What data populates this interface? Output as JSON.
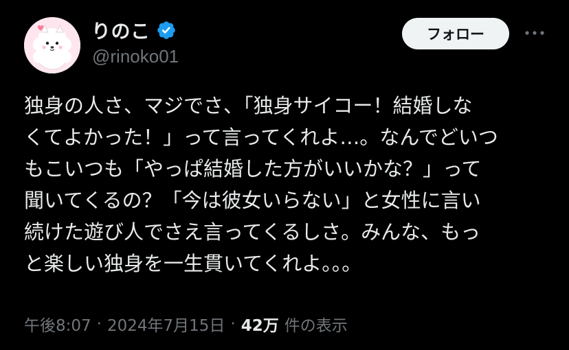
{
  "user": {
    "display_name": "りのこ",
    "handle": "@rinoko01",
    "verified_color": "#1d9bf0"
  },
  "actions": {
    "follow_label": "フォロー",
    "more_icon": "more-horizontal-icon"
  },
  "tweet": {
    "lines": [
      "独身の人さ、マジでさ、「独身サイコー！結婚しな",
      "くてよかった！」って言ってくれよ…。なんでどいつ",
      "もこいつも「やっぱ結婚した方がいいかな？」って",
      "聞いてくるの？「今は彼女いらない」と女性に言い",
      "続けた遊び人でさえ言ってくるしさ。みんな、もっ",
      "と楽しい独身を一生貫いてくれよ。。。"
    ]
  },
  "meta": {
    "time": "午後8:07",
    "separator": "·",
    "date": "2024年7月15日",
    "views_count": "42万",
    "views_label": "件の表示"
  },
  "colors": {
    "background": "#000000",
    "primary_text": "#e7e9ea",
    "secondary_text": "#71767b",
    "follow_bg": "#eff3f4",
    "avatar_bg": "#ffe6ee"
  }
}
